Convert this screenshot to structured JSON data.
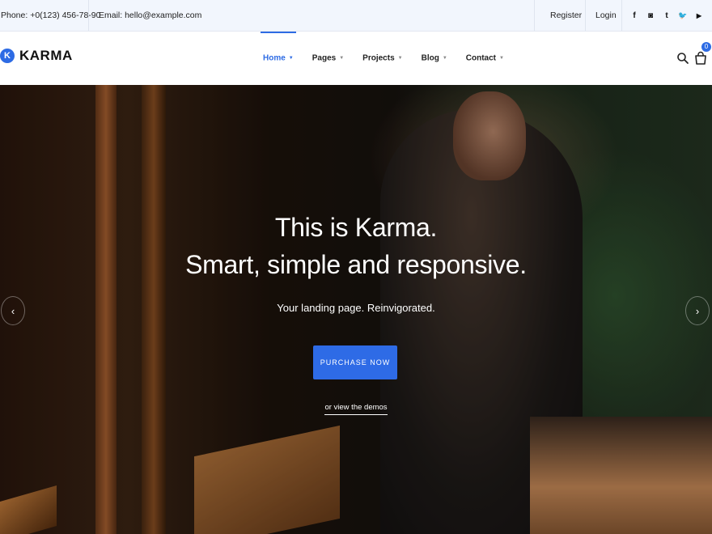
{
  "topbar": {
    "phone": "Phone: +0(123) 456-78-90",
    "email": "Email: hello@example.com",
    "register": "Register",
    "login": "Login",
    "social": [
      {
        "name": "facebook-icon",
        "glyph": "f"
      },
      {
        "name": "instagram-icon",
        "glyph": "◙"
      },
      {
        "name": "tumblr-icon",
        "glyph": "t"
      },
      {
        "name": "twitter-icon",
        "glyph": "🐦"
      },
      {
        "name": "youtube-icon",
        "glyph": "▶"
      }
    ]
  },
  "header": {
    "logo_mark": "K",
    "logo_text": "KARMA",
    "nav": [
      {
        "label": "Home",
        "active": true
      },
      {
        "label": "Pages"
      },
      {
        "label": "Projects"
      },
      {
        "label": "Blog"
      },
      {
        "label": "Contact"
      }
    ],
    "cart_count": "0"
  },
  "hero": {
    "line1": "This is Karma.",
    "line2": "Smart, simple and responsive.",
    "subtitle": "Your landing page. Reinvigorated.",
    "button": "PURCHASE NOW",
    "link": "or view the demos",
    "prev_arrow": "‹",
    "next_arrow": "›"
  },
  "colors": {
    "accent": "#2d6be4",
    "topbar_bg": "#f2f6fd"
  }
}
